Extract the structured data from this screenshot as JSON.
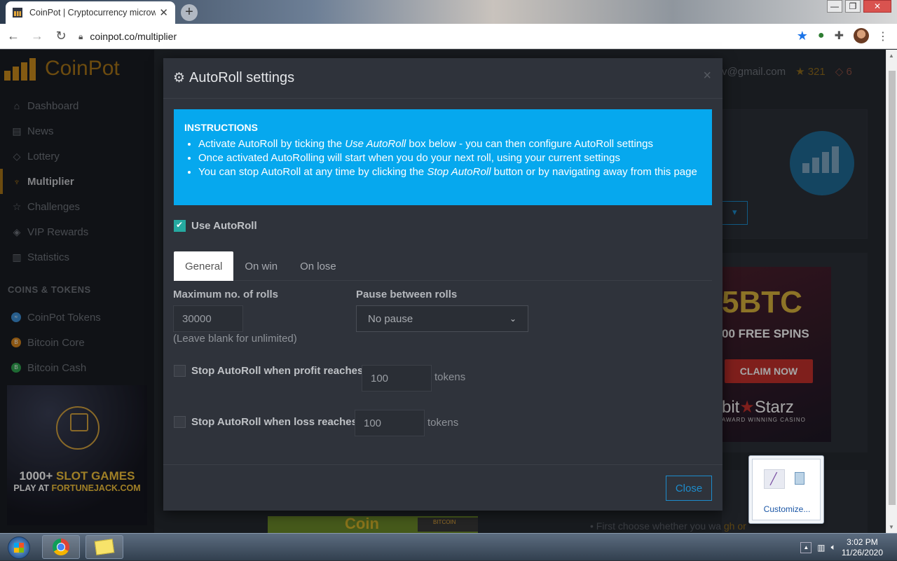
{
  "browser": {
    "tab_title": "CoinPot | Cryptocurrency microw",
    "new_tab_icon": "plus-icon",
    "address": "coinpot.co/multiplier"
  },
  "sidebar": {
    "brand": "CoinPot",
    "nav": [
      {
        "label": "Dashboard",
        "icon": "home-icon"
      },
      {
        "label": "News",
        "icon": "news-icon"
      },
      {
        "label": "Lottery",
        "icon": "ticket-icon"
      },
      {
        "label": "Multiplier",
        "icon": "trophy-icon"
      },
      {
        "label": "Challenges",
        "icon": "star-icon"
      },
      {
        "label": "VIP Rewards",
        "icon": "diamond-icon"
      },
      {
        "label": "Statistics",
        "icon": "bar-chart-icon"
      }
    ],
    "section_title": "COINS & TOKENS",
    "coins": [
      {
        "label": "CoinPot Tokens",
        "color": "#3d8fd6"
      },
      {
        "label": "Bitcoin Core",
        "color": "#d6851d"
      },
      {
        "label": "Bitcoin Cash",
        "color": "#2ea44f"
      }
    ],
    "ad": {
      "line1a": "1000+ ",
      "line1b": "SLOT GAMES",
      "line2a": "PLAY AT ",
      "line2b": "FORTUNEJACK.COM"
    }
  },
  "header": {
    "email_fragment": "v@gmail.com",
    "stars": "321",
    "tags": "6"
  },
  "right_ad": {
    "line1": "5BTC",
    "line2": "00 FREE SPINS",
    "cta": "CLAIM NOW",
    "brand_a": "bit",
    "brand_b": "Starz",
    "tagline": "AWARD WINNING CASINO"
  },
  "right_text": {
    "a": "First choose whether you wa",
    "b": "gh or"
  },
  "bottom_ad": {
    "coin": "Coin",
    "badge": "BITCOIN"
  },
  "modal": {
    "title": "AutoRoll settings",
    "instructions_heading": "INSTRUCTIONS",
    "instr": [
      {
        "pre": "Activate AutoRoll by ticking the ",
        "em": "Use AutoRoll",
        "post": " box below - you can then configure AutoRoll settings"
      },
      {
        "pre": "Once activated AutoRolling will start when you do your next roll, using your current settings",
        "em": "",
        "post": ""
      },
      {
        "pre": "You can stop AutoRoll at any time by clicking the ",
        "em": "Stop AutoRoll",
        "post": " button or by navigating away from this page"
      }
    ],
    "use_autoroll": "Use AutoRoll",
    "tabs": [
      "General",
      "On win",
      "On lose"
    ],
    "max_rolls_label": "Maximum no. of rolls",
    "max_rolls_value": "30000",
    "max_rolls_hint": "(Leave blank for unlimited)",
    "pause_label": "Pause between rolls",
    "pause_value": "No pause",
    "stop_profit_label": "Stop AutoRoll when profit reaches",
    "stop_profit_value": "100",
    "stop_loss_label": "Stop AutoRoll when loss reaches",
    "stop_loss_value": "100",
    "unit": "tokens",
    "close": "Close"
  },
  "tray_popup": {
    "customize": "Customize..."
  },
  "taskbar": {
    "time": "3:02 PM",
    "date": "11/26/2020"
  }
}
